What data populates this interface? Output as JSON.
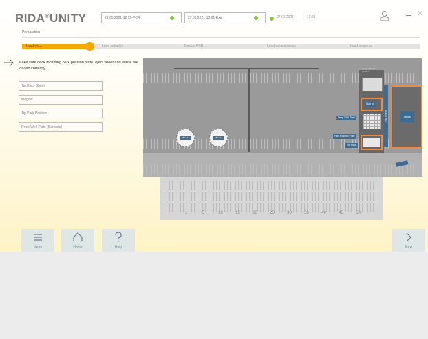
{
  "header": {
    "logo": "RIDA",
    "logo_reg": "®",
    "logo_suffix": "UNITY",
    "selector1": "21.05.2021-12:15-PCR",
    "selector2": "27.01.2021-13:01-Extr",
    "date": "27.01.2021",
    "time": "13:21",
    "status_color": "#8cc63f"
  },
  "breadcrumb": "Preparation",
  "steps": [
    {
      "label": "Load deck",
      "active": true
    },
    {
      "label": "Load samples"
    },
    {
      "label": "Design PCR"
    },
    {
      "label": "Load consumables"
    },
    {
      "label": "Load reagents"
    }
  ],
  "progress": 0.17,
  "instruction": "Make sure deck including park position plate, eject sheet and waste are loaded correctly",
  "checklist": [
    "Tip Eject Sheet",
    "Magnet",
    "Tip Park Position",
    "Deep Well Plate (Barcode)"
  ],
  "deck": {
    "circle1": "Box 1",
    "circle2": "Box 2",
    "stop_kit": "Stop kit",
    "deep_well": "Deep Well Plate",
    "park_position": "Park Position Plate",
    "tip_rack": "Tip Rack",
    "vert_label": "Cooling Block",
    "right_unit": "Waste",
    "top_text": "Reagent block position"
  },
  "plate_numbers": [
    "1",
    "5",
    "10",
    "15",
    "20",
    "25",
    "30",
    "35",
    "40",
    "45",
    "50"
  ],
  "nav": {
    "menu": "Menu",
    "home": "Home",
    "help": "Help",
    "next": "Next"
  },
  "colors": {
    "accent": "#f5a900",
    "deck_blue": "#3d6b92",
    "highlight": "#f08a3e"
  }
}
